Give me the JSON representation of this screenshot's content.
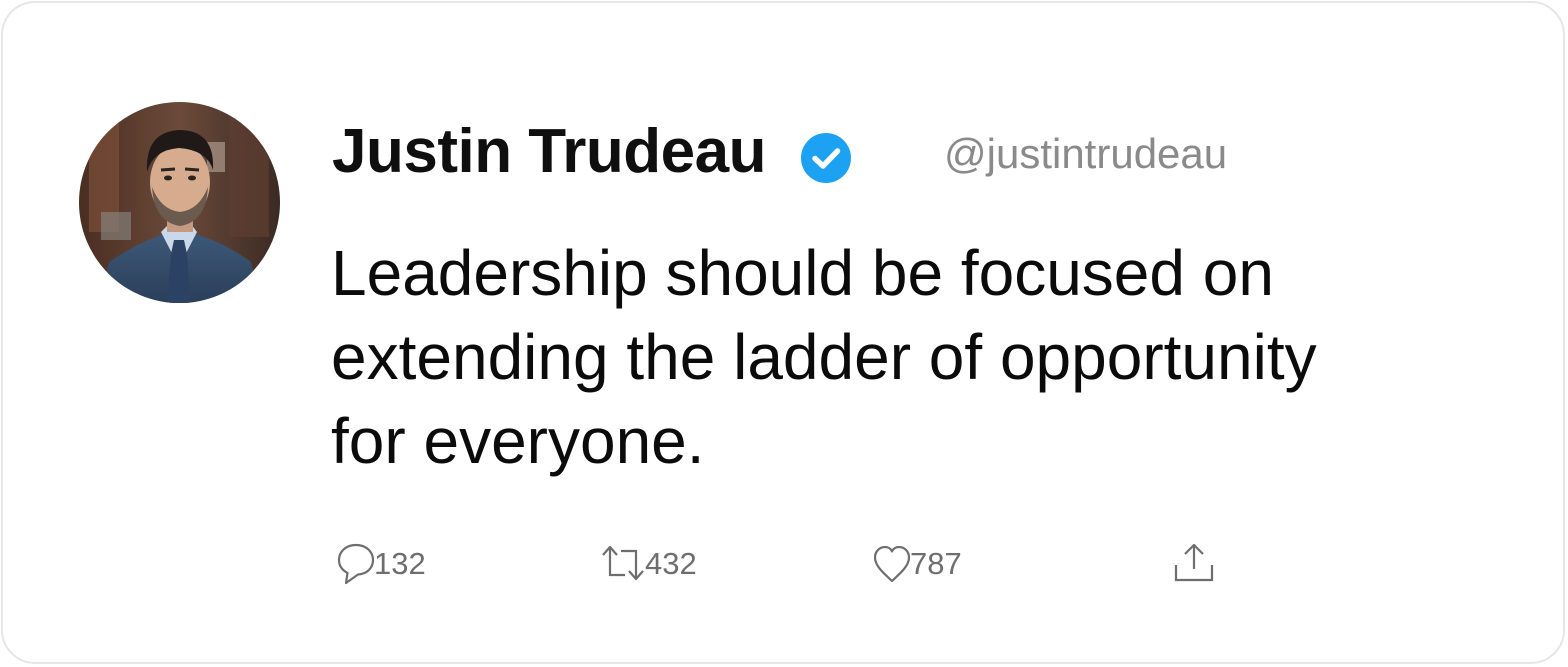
{
  "tweet": {
    "author": {
      "display_name": "Justin Trudeau",
      "handle": "@justintrudeau",
      "verified": true,
      "avatar": "profile-photo"
    },
    "text_lines": [
      "Leadership should be focused on",
      "extending the ladder of opportunity",
      "for everyone."
    ],
    "actions": {
      "reply": {
        "icon": "reply-icon",
        "count": "132"
      },
      "retweet": {
        "icon": "retweet-icon",
        "count": "432"
      },
      "like": {
        "icon": "heart-icon",
        "count": "787"
      },
      "share": {
        "icon": "share-icon"
      }
    }
  },
  "colors": {
    "verified_badge": "#1da1f2",
    "handle_text": "#8a8a8a",
    "action_gray": "#6e6e6e",
    "card_border": "#e6e6e6"
  }
}
